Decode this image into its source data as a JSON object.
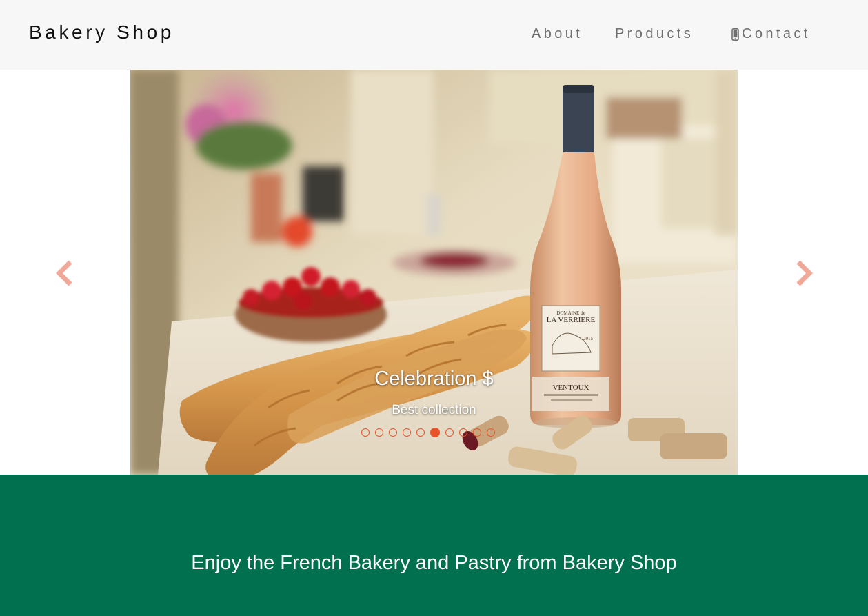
{
  "navbar": {
    "brand": "Bakery Shop",
    "links": {
      "about": "About",
      "products": "Products",
      "contact": "Contact"
    },
    "contact_icon": "mobile-phone-icon"
  },
  "carousel": {
    "slide": {
      "title": "Celebration $",
      "subtitle": "Best collection",
      "image": "baguettes-and-rose-wine-bottle-photo",
      "bottle_label": {
        "line1": "DOMAINE de",
        "line2": "LA VERRIERE",
        "year": "2015",
        "appellation": "VENTOUX"
      }
    },
    "indicators": {
      "count": 10,
      "active_index": 5
    },
    "prev_icon": "chevron-left-icon",
    "next_icon": "chevron-right-icon"
  },
  "banner": {
    "text": "Enjoy the French Bakery and Pastry from Bakery Shop"
  },
  "colors": {
    "navbar_bg": "#f7f7f7",
    "banner_bg": "#00704e",
    "accent": "#e8542a",
    "arrow": "#f0a898"
  }
}
